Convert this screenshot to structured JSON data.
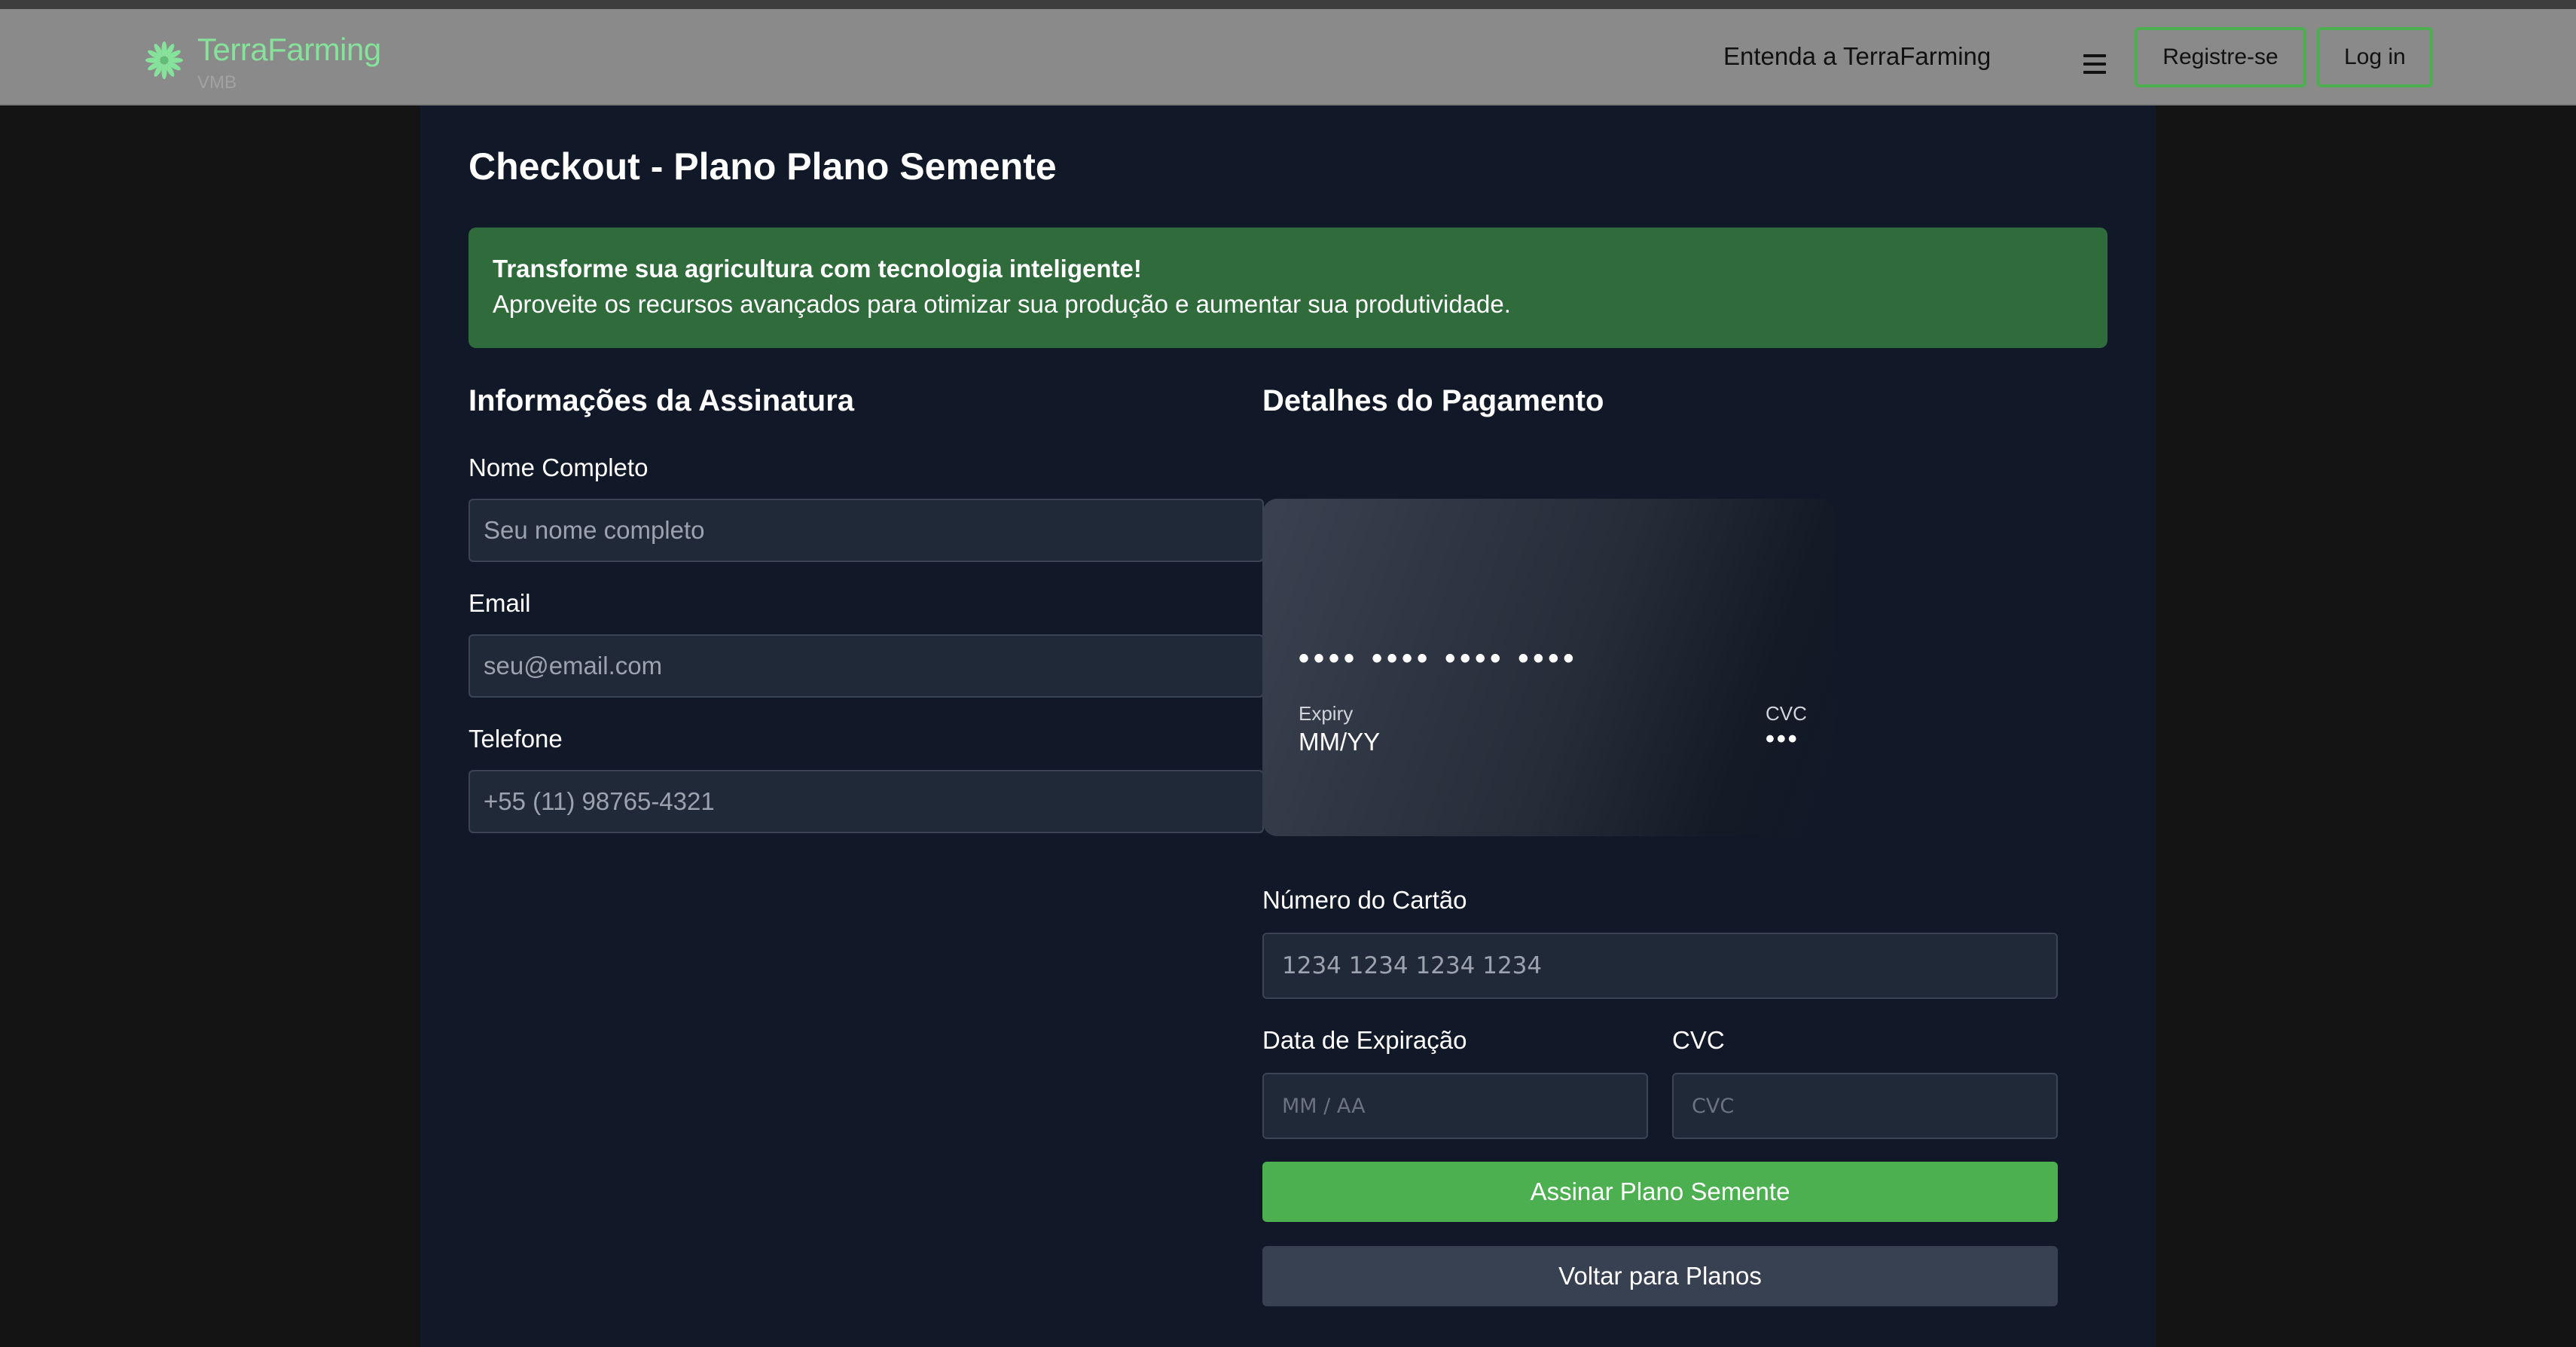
{
  "colors": {
    "brand": "#86e29a",
    "accent_green": "#4caf50",
    "banner_bg": "#2f6b3b",
    "page_bg": "#111827",
    "navbar_bg": "#8a8a8a"
  },
  "navbar": {
    "logo_icon": "sunburst-leaf-icon",
    "brand_name": "TerraFarming",
    "brand_sub": "VMB",
    "link_about": "Entenda a TerraFarming",
    "menu_icon": "hamburger-menu-icon",
    "register_label": "Registre-se",
    "login_label": "Log in"
  },
  "page": {
    "title": "Checkout - Plano Plano Semente"
  },
  "banner": {
    "title": "Transforme sua agricultura com tecnologia inteligente!",
    "text": "Aproveite os recursos avançados para otimizar sua produção e aumentar sua produtividade."
  },
  "subscription": {
    "title": "Informações da Assinatura",
    "name_label": "Nome Completo",
    "name_placeholder": "Seu nome completo",
    "email_label": "Email",
    "email_placeholder": "seu@email.com",
    "phone_label": "Telefone",
    "phone_placeholder": "+55 (11) 98765-4321"
  },
  "payment": {
    "title": "Detalhes do Pagamento",
    "card_preview": {
      "number": "•••• •••• •••• ••••",
      "expiry_label": "Expiry",
      "expiry_value": "MM/YY",
      "cvc_label": "CVC",
      "cvc_value": "•••"
    },
    "card_number_label": "Número do Cartão",
    "card_number_placeholder": "1234 1234 1234 1234",
    "expiry_label": "Data de Expiração",
    "expiry_placeholder": "MM / AA",
    "cvc_label": "CVC",
    "cvc_placeholder": "CVC",
    "submit_label": "Assinar Plano Semente",
    "back_label": "Voltar para Planos"
  }
}
